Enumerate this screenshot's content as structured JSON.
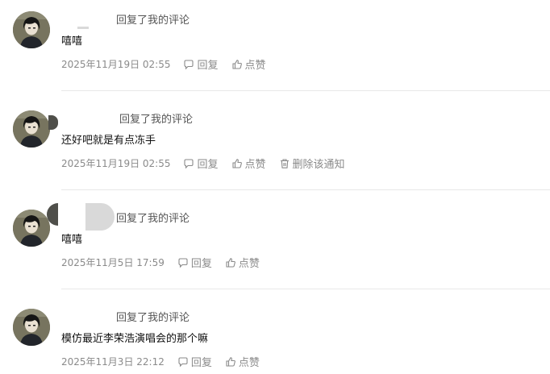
{
  "colors": {
    "meta_text": "#8a8a8a",
    "header_text": "#555555",
    "content_text": "#111111",
    "divider": "#e8e8e8"
  },
  "comments": [
    {
      "header": "回复了我的评论",
      "content": "嘻嘻",
      "time": "2025年11月19日 02:55",
      "reply_label": "回复",
      "like_label": "点赞"
    },
    {
      "header": "回复了我的评论",
      "content": "还好吧就是有点冻手",
      "time": "2025年11月19日 02:55",
      "reply_label": "回复",
      "like_label": "点赞",
      "delete_label": "删除该通知"
    },
    {
      "header": "回复了我的评论",
      "content": "嘻嘻",
      "time": "2025年11月5日 17:59",
      "reply_label": "回复",
      "like_label": "点赞"
    },
    {
      "header": "回复了我的评论",
      "content": "模仿最近李荣浩演唱会的那个嘛",
      "time": "2025年11月3日 22:12",
      "reply_label": "回复",
      "like_label": "点赞"
    }
  ]
}
